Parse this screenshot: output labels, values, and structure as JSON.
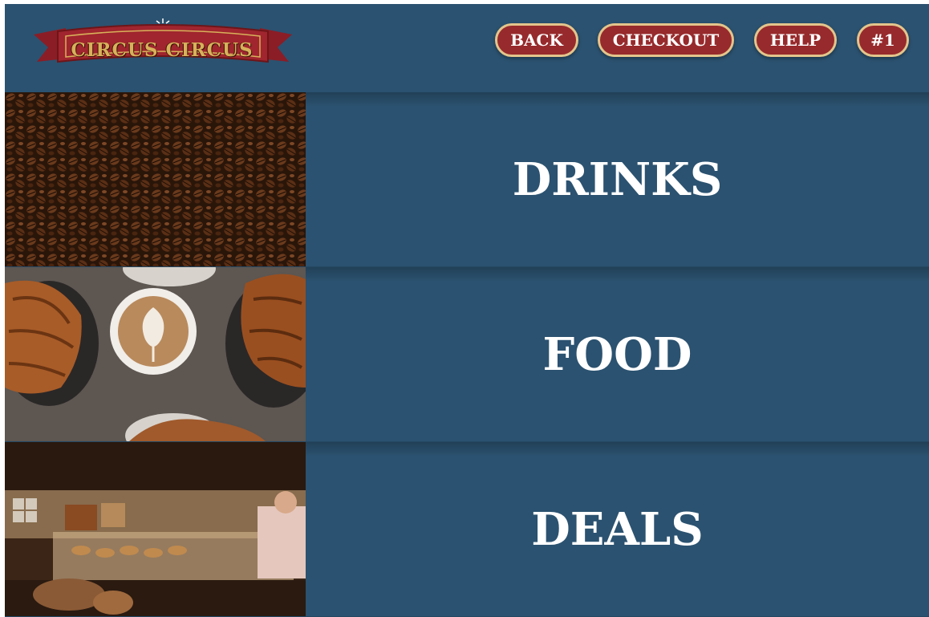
{
  "header": {
    "logo_text": "CIRCUS CIRCUS",
    "nav": {
      "back_label": "BACK",
      "checkout_label": "CHECKOUT",
      "help_label": "HELP",
      "order_number_label": "#1"
    }
  },
  "categories": [
    {
      "label": "DRINKS",
      "image": "coffee-beans-photo"
    },
    {
      "label": "FOOD",
      "image": "latte-and-croissants-photo"
    },
    {
      "label": "DEALS",
      "image": "bakery-counter-photo"
    }
  ],
  "colors": {
    "background": "#2b5270",
    "button_fill": "#972a2c",
    "button_border": "#e3c58c",
    "logo_banner": "#a0252e",
    "logo_text": "#d8b15a"
  }
}
